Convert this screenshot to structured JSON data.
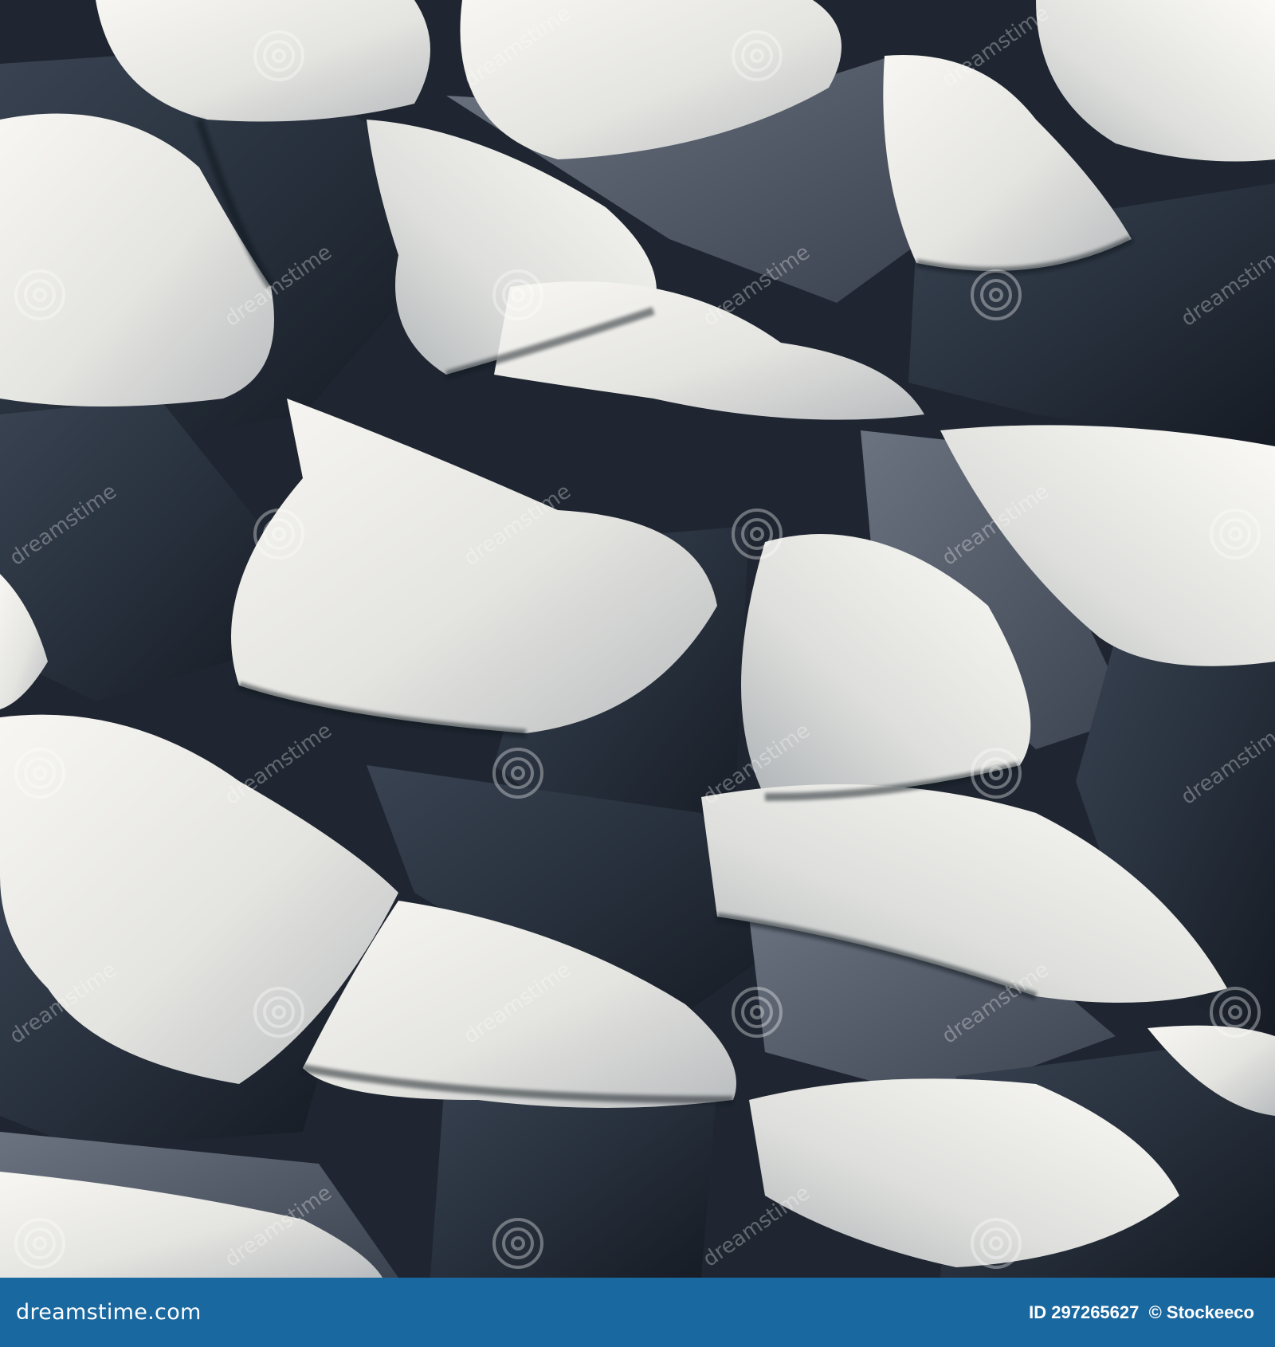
{
  "image": {
    "subject": "3D render of interlocking white and dark navy sculpted tiles",
    "colors": {
      "light_tile": "#e6e6e2",
      "light_tile_highlight": "#f7f6f2",
      "dark_tile": "#27303c",
      "dark_tile_deep": "#1a202a",
      "gray_tile": "#5a6270",
      "footer_background": "#1a68a0"
    }
  },
  "watermark": {
    "text": "dreamstime",
    "logo": "dreamstime-spiral-logo"
  },
  "footer": {
    "brand": "dreamstime.com",
    "id_text": "ID 297265627",
    "credit": "© Stockeeco"
  }
}
